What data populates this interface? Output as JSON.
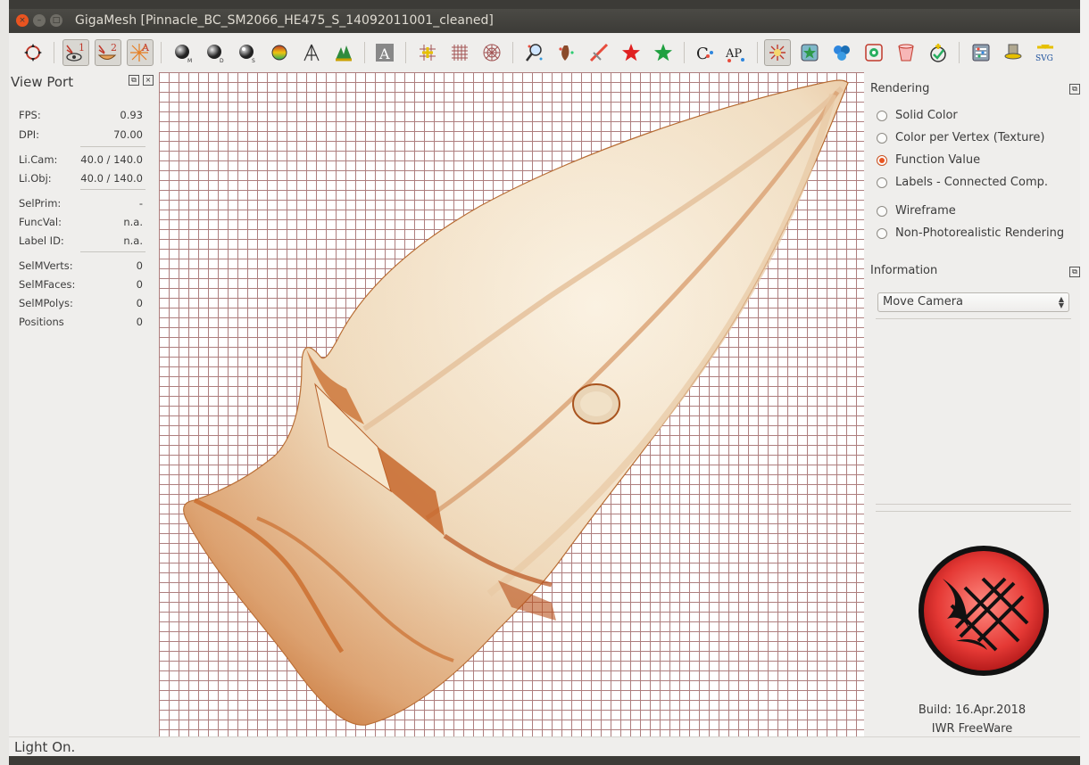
{
  "window": {
    "title": "GigaMesh [Pinnacle_BC_SM2066_HE475_S_14092011001_cleaned]",
    "controls": {
      "close": "×",
      "minimize": "–",
      "maximize": "□"
    }
  },
  "toolbar": {
    "items": [
      {
        "name": "reset-view-icon",
        "checked": false
      },
      {
        "name": "light-1-icon",
        "label": "1",
        "checked": true
      },
      {
        "name": "light-2-icon",
        "label": "2",
        "checked": true
      },
      {
        "name": "light-a-icon",
        "label": "A",
        "checked": true
      },
      {
        "name": "shade-m-icon",
        "label": "M"
      },
      {
        "name": "shade-d-icon",
        "label": "D"
      },
      {
        "name": "shade-s-icon",
        "label": "S"
      },
      {
        "name": "shade-colormap-icon"
      },
      {
        "name": "shade-transparency-icon"
      },
      {
        "name": "histogram-icon"
      },
      {
        "name": "font-a-icon",
        "label": "A"
      },
      {
        "name": "grid-plus-icon"
      },
      {
        "name": "grid-icon"
      },
      {
        "name": "polar-grid-icon"
      },
      {
        "name": "selection-search-icon"
      },
      {
        "name": "vertex-select-icon"
      },
      {
        "name": "polyline-icon"
      },
      {
        "name": "star-red-icon"
      },
      {
        "name": "star-green-icon"
      },
      {
        "name": "face-c-icon",
        "label": "C"
      },
      {
        "name": "ap-icon",
        "label": "AP"
      },
      {
        "name": "light-direction-icon",
        "checked": true
      },
      {
        "name": "star-frame-icon"
      },
      {
        "name": "cluster-icon"
      },
      {
        "name": "green-gear-icon"
      },
      {
        "name": "cup-icon"
      },
      {
        "name": "check-plus-icon"
      },
      {
        "name": "settings-list-icon"
      },
      {
        "name": "hat-icon"
      },
      {
        "name": "svg-export-icon",
        "label": "SVG"
      }
    ]
  },
  "viewport_panel": {
    "title": "View Port",
    "rows": [
      {
        "label": "FPS:",
        "value": "0.93"
      },
      {
        "label": "DPI:",
        "value": "70.00"
      },
      {
        "label": "Li.Cam:",
        "value": "40.0 / 140.0"
      },
      {
        "label": "Li.Obj:",
        "value": "40.0 / 140.0"
      },
      {
        "label": "SelPrim:",
        "value": "-"
      },
      {
        "label": "FuncVal:",
        "value": "n.a."
      },
      {
        "label": "Label ID:",
        "value": "n.a."
      },
      {
        "label": "SelMVerts:",
        "value": "0"
      },
      {
        "label": "SelMFaces:",
        "value": "0"
      },
      {
        "label": "SelMPolys:",
        "value": "0"
      },
      {
        "label": "Positions",
        "value": "0"
      }
    ]
  },
  "rendering": {
    "title": "Rendering",
    "options": [
      {
        "label": "Solid Color",
        "checked": false
      },
      {
        "label": "Color per Vertex (Texture)",
        "checked": false
      },
      {
        "label": "Function Value",
        "checked": true
      },
      {
        "label": "Labels - Connected Comp.",
        "checked": false
      },
      {
        "label": "Wireframe",
        "checked": false
      },
      {
        "label": "Non-Photorealistic Rendering",
        "checked": false
      }
    ]
  },
  "information": {
    "title": "Information",
    "mode_selected": "Move Camera"
  },
  "about": {
    "build": "Build: 16.Apr.2018",
    "license": "IWR FreeWare"
  },
  "status": {
    "text": "Light On."
  },
  "colors": {
    "accent": "#e95420",
    "grid": "#a06868",
    "logo_red": "#e53935"
  }
}
